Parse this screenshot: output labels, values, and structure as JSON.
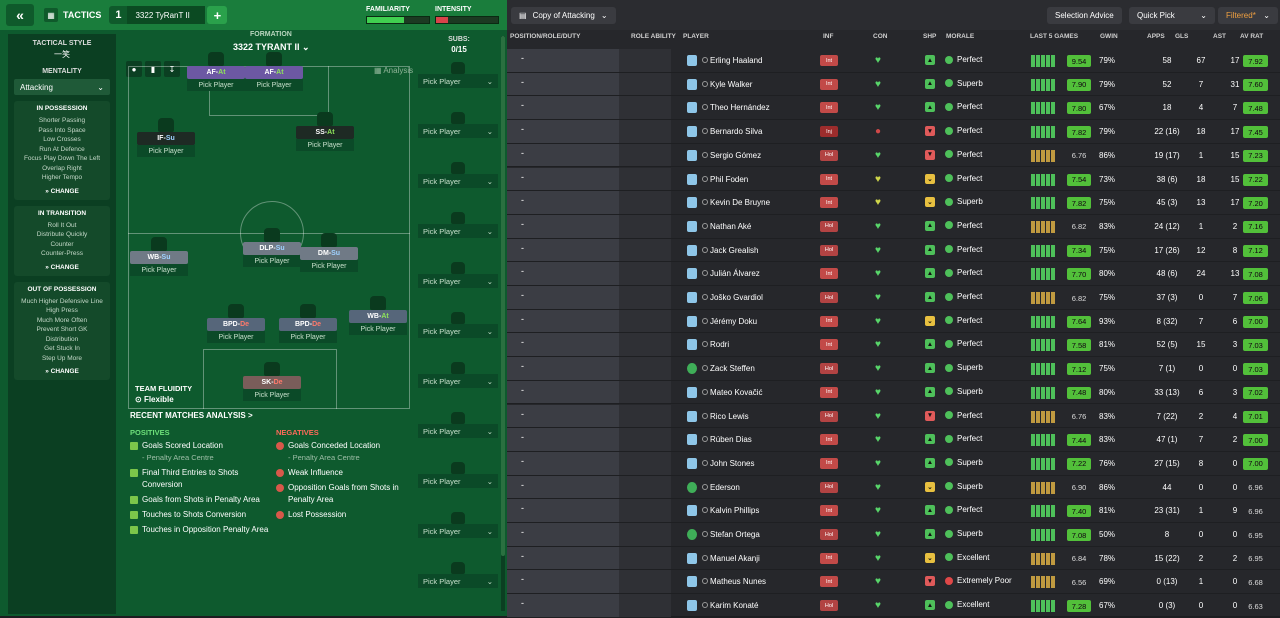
{
  "header": {
    "back_icon": "double-chevron-left-icon",
    "tactics_label": "TACTICS",
    "tab_number": "1",
    "tab_name": "3322 TyRanT II",
    "familiarity_label": "FAMILIARITY",
    "familiarity_level": 0.6,
    "intensity_label": "INTENSITY",
    "intensity_level": 0.2,
    "familiarity_color": "#40d050",
    "intensity_color": "#d9444a"
  },
  "side": {
    "tactical_style_label": "TACTICAL STYLE",
    "tactical_style_value": "一笑",
    "mentality_label": "MENTALITY",
    "mentality_value": "Attacking",
    "in_possession": {
      "title": "IN POSSESSION",
      "items": [
        "Shorter Passing",
        "Pass Into Space",
        "Low Crosses",
        "Run At Defence",
        "Focus Play Down The Left",
        "Overlap Right",
        "Higher Tempo"
      ],
      "change": "CHANGE"
    },
    "in_transition": {
      "title": "IN TRANSITION",
      "items": [
        "Roll It Out",
        "Distribute Quickly",
        "Counter",
        "Counter-Press"
      ],
      "change": "CHANGE"
    },
    "out_of_possession": {
      "title": "OUT OF POSSESSION",
      "items": [
        "Much Higher Defensive Line",
        "High Press",
        "Much More Often",
        "Prevent Short GK",
        "Distribution",
        "Get Stuck In",
        "Step Up More"
      ],
      "change": "CHANGE"
    }
  },
  "formation": {
    "label": "FORMATION",
    "name": "3322 TYRANT II",
    "analysis": "Analysis",
    "subs_label": "SUBS:",
    "subs_count": "0/15",
    "slots": [
      {
        "role": "AF",
        "duty": "At",
        "pick": "Pick Player"
      },
      {
        "role": "AF",
        "duty": "At",
        "pick": "Pick Player"
      },
      {
        "role": "IF",
        "duty": "Su",
        "pick": "Pick Player"
      },
      {
        "role": "SS",
        "duty": "At",
        "pick": "Pick Player"
      },
      {
        "role": "WB",
        "duty": "Su",
        "pick": "Pick Player"
      },
      {
        "role": "DLP",
        "duty": "Su",
        "pick": "Pick Player"
      },
      {
        "role": "DM",
        "duty": "Su",
        "pick": "Pick Player"
      },
      {
        "role": "BPD",
        "duty": "De",
        "pick": "Pick Player"
      },
      {
        "role": "BPD",
        "duty": "De",
        "pick": "Pick Player"
      },
      {
        "role": "WB",
        "duty": "At",
        "pick": "Pick Player"
      },
      {
        "role": "SK",
        "duty": "De",
        "pick": "Pick Player"
      }
    ],
    "sub_pick": "Pick Player",
    "team_fluidity_label": "TEAM FLUIDITY",
    "team_fluidity_value": "Flexible"
  },
  "recent": {
    "title": "RECENT MATCHES ANALYSIS >",
    "positives_label": "POSITIVES",
    "negatives_label": "NEGATIVES",
    "positives": [
      {
        "text": "Goals Scored Location",
        "sub": "- Penalty Area Centre"
      },
      {
        "text": "Final Third Entries to Shots Conversion",
        "sub": ""
      },
      {
        "text": "Goals from Shots in Penalty Area",
        "sub": ""
      },
      {
        "text": "Touches to Shots Conversion",
        "sub": ""
      },
      {
        "text": "Touches in Opposition Penalty Area",
        "sub": ""
      }
    ],
    "negatives": [
      {
        "text": "Goals Conceded Location",
        "sub": "- Penalty Area Centre"
      },
      {
        "text": "Weak Influence",
        "sub": ""
      },
      {
        "text": "Opposition Goals from Shots in Penalty Area",
        "sub": ""
      },
      {
        "text": "Lost Possession",
        "sub": ""
      }
    ]
  },
  "right_toolbar": {
    "copy_label": "Copy of Attacking",
    "selection_advice": "Selection Advice",
    "quick_pick": "Quick Pick",
    "filtered": "Filtered"
  },
  "table": {
    "columns": [
      "POSITION/ROLE/DUTY",
      "ROLE ABILITY",
      "PLAYER",
      "INF",
      "CON",
      "SHP",
      "MORALE",
      "LAST 5 GAMES",
      "GWIN",
      "APPS",
      "GLS",
      "AST",
      "AV RAT"
    ],
    "rows": [
      {
        "name": "Erling Haaland",
        "inf": "Int",
        "con": "g",
        "shp": "g",
        "morale": "Perfect",
        "l5": "9.54",
        "l5g": true,
        "gwin": "79%",
        "apps": "58",
        "gls": "67",
        "ast": "17",
        "avr": "7.92",
        "avg": true
      },
      {
        "name": "Kyle Walker",
        "inf": "Int",
        "con": "g",
        "shp": "g",
        "morale": "Superb",
        "l5": "7.90",
        "l5g": true,
        "gwin": "79%",
        "apps": "52",
        "gls": "7",
        "ast": "31",
        "avr": "7.60",
        "avg": true
      },
      {
        "name": "Theo Hernández",
        "inf": "Int",
        "con": "g",
        "shp": "g",
        "morale": "Perfect",
        "l5": "7.80",
        "l5g": true,
        "gwin": "67%",
        "apps": "18",
        "gls": "4",
        "ast": "7",
        "avr": "7.48",
        "avg": true
      },
      {
        "name": "Bernardo Silva",
        "inf": "Inj",
        "con": "r",
        "shp": "r",
        "morale": "Perfect",
        "l5": "7.82",
        "l5g": true,
        "gwin": "79%",
        "apps": "22 (16)",
        "gls": "18",
        "ast": "17",
        "avr": "7.45",
        "avg": true
      },
      {
        "name": "Sergio Gómez",
        "inf": "Hol",
        "con": "g",
        "shp": "r",
        "morale": "Perfect",
        "l5": "6.76",
        "l5g": false,
        "gwin": "86%",
        "apps": "19 (17)",
        "gls": "1",
        "ast": "15",
        "avr": "7.23",
        "avg": true
      },
      {
        "name": "Phil Foden",
        "inf": "Int",
        "con": "y",
        "shp": "y",
        "morale": "Perfect",
        "l5": "7.54",
        "l5g": true,
        "gwin": "73%",
        "apps": "38 (6)",
        "gls": "18",
        "ast": "15",
        "avr": "7.22",
        "avg": true
      },
      {
        "name": "Kevin De Bruyne",
        "inf": "Int",
        "con": "y",
        "shp": "y",
        "morale": "Superb",
        "l5": "7.82",
        "l5g": true,
        "gwin": "75%",
        "apps": "45 (3)",
        "gls": "13",
        "ast": "17",
        "avr": "7.20",
        "avg": true
      },
      {
        "name": "Nathan Aké",
        "inf": "Hol",
        "con": "g",
        "shp": "g",
        "morale": "Perfect",
        "l5": "6.82",
        "l5g": false,
        "gwin": "83%",
        "apps": "24 (12)",
        "gls": "1",
        "ast": "2",
        "avr": "7.16",
        "avg": true
      },
      {
        "name": "Jack Grealish",
        "inf": "Hol",
        "con": "g",
        "shp": "g",
        "morale": "Perfect",
        "l5": "7.34",
        "l5g": true,
        "gwin": "75%",
        "apps": "17 (26)",
        "gls": "12",
        "ast": "8",
        "avr": "7.12",
        "avg": true
      },
      {
        "name": "Julián Álvarez",
        "inf": "Int",
        "con": "g",
        "shp": "g",
        "morale": "Perfect",
        "l5": "7.70",
        "l5g": true,
        "gwin": "80%",
        "apps": "48 (6)",
        "gls": "24",
        "ast": "13",
        "avr": "7.08",
        "avg": true
      },
      {
        "name": "Joško Gvardiol",
        "inf": "Hol",
        "con": "g",
        "shp": "g",
        "morale": "Perfect",
        "l5": "6.82",
        "l5g": false,
        "gwin": "75%",
        "apps": "37 (3)",
        "gls": "0",
        "ast": "7",
        "avr": "7.06",
        "avg": true
      },
      {
        "name": "Jérémy Doku",
        "inf": "Int",
        "con": "g",
        "shp": "y",
        "morale": "Perfect",
        "l5": "7.64",
        "l5g": true,
        "gwin": "93%",
        "apps": "8 (32)",
        "gls": "7",
        "ast": "6",
        "avr": "7.00",
        "avg": true
      },
      {
        "name": "Rodri",
        "inf": "Int",
        "con": "g",
        "shp": "g",
        "morale": "Perfect",
        "l5": "7.58",
        "l5g": true,
        "gwin": "81%",
        "apps": "52 (5)",
        "gls": "15",
        "ast": "3",
        "avr": "7.03",
        "avg": true
      },
      {
        "name": "Zack Steffen",
        "inf": "Hol",
        "con": "g",
        "shp": "g",
        "morale": "Superb",
        "l5": "7.12",
        "l5g": true,
        "gwin": "75%",
        "apps": "7 (1)",
        "gls": "0",
        "ast": "0",
        "avr": "7.03",
        "avg": true
      },
      {
        "name": "Mateo Kovačić",
        "inf": "Int",
        "con": "g",
        "shp": "g",
        "morale": "Superb",
        "l5": "7.48",
        "l5g": true,
        "gwin": "80%",
        "apps": "33 (13)",
        "gls": "6",
        "ast": "3",
        "avr": "7.02",
        "avg": true
      },
      {
        "name": "Rico Lewis",
        "inf": "Hol",
        "con": "g",
        "shp": "r",
        "morale": "Perfect",
        "l5": "6.76",
        "l5g": false,
        "gwin": "83%",
        "apps": "7 (22)",
        "gls": "2",
        "ast": "4",
        "avr": "7.01",
        "avg": true
      },
      {
        "name": "Rúben Dias",
        "inf": "Int",
        "con": "g",
        "shp": "g",
        "morale": "Perfect",
        "l5": "7.44",
        "l5g": true,
        "gwin": "83%",
        "apps": "47 (1)",
        "gls": "7",
        "ast": "2",
        "avr": "7.00",
        "avg": true
      },
      {
        "name": "John Stones",
        "inf": "Int",
        "con": "g",
        "shp": "g",
        "morale": "Superb",
        "l5": "7.22",
        "l5g": true,
        "gwin": "76%",
        "apps": "27 (15)",
        "gls": "8",
        "ast": "0",
        "avr": "7.00",
        "avg": true
      },
      {
        "name": "Ederson",
        "inf": "Hol",
        "con": "g",
        "shp": "y",
        "morale": "Superb",
        "l5": "6.90",
        "l5g": false,
        "gwin": "86%",
        "apps": "44",
        "gls": "0",
        "ast": "0",
        "avr": "6.96",
        "avg": false
      },
      {
        "name": "Kalvin Phillips",
        "inf": "Int",
        "con": "g",
        "shp": "g",
        "morale": "Perfect",
        "l5": "7.40",
        "l5g": true,
        "gwin": "81%",
        "apps": "23 (31)",
        "gls": "1",
        "ast": "9",
        "avr": "6.96",
        "avg": false
      },
      {
        "name": "Stefan Ortega",
        "inf": "Hol",
        "con": "g",
        "shp": "g",
        "morale": "Superb",
        "l5": "7.08",
        "l5g": true,
        "gwin": "50%",
        "apps": "8",
        "gls": "0",
        "ast": "0",
        "avr": "6.95",
        "avg": false
      },
      {
        "name": "Manuel Akanji",
        "inf": "Int",
        "con": "g",
        "shp": "y",
        "morale": "Excellent",
        "l5": "6.84",
        "l5g": false,
        "gwin": "78%",
        "apps": "15 (22)",
        "gls": "2",
        "ast": "2",
        "avr": "6.95",
        "avg": false
      },
      {
        "name": "Matheus Nunes",
        "inf": "Int",
        "con": "g",
        "shp": "r",
        "morale": "Extremely Poor",
        "l5": "6.56",
        "l5g": false,
        "gwin": "69%",
        "apps": "0 (13)",
        "gls": "1",
        "ast": "0",
        "avr": "6.68",
        "avg": false
      },
      {
        "name": "Karim Konaté",
        "inf": "Hol",
        "con": "g",
        "shp": "g",
        "morale": "Excellent",
        "l5": "7.28",
        "l5g": true,
        "gwin": "67%",
        "apps": "0 (3)",
        "gls": "0",
        "ast": "0",
        "avr": "6.63",
        "avg": false
      }
    ]
  }
}
